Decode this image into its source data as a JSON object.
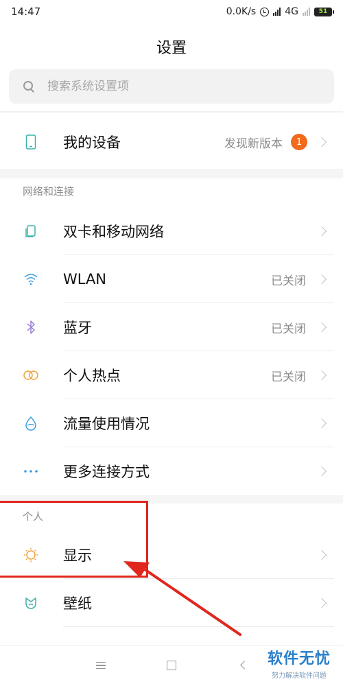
{
  "status_bar": {
    "time": "14:47",
    "speed": "0.0K/s",
    "network": "4G",
    "battery": "51"
  },
  "page_title": "设置",
  "search": {
    "placeholder": "搜索系统设置项"
  },
  "device": {
    "label": "我的设备",
    "value": "发现新版本",
    "badge": "1"
  },
  "network_section": {
    "title": "网络和连接",
    "items": [
      {
        "label": "双卡和移动网络",
        "value": "",
        "icon": "sim-cards-icon"
      },
      {
        "label": "WLAN",
        "value": "已关闭",
        "icon": "wifi-icon"
      },
      {
        "label": "蓝牙",
        "value": "已关闭",
        "icon": "bluetooth-icon"
      },
      {
        "label": "个人热点",
        "value": "已关闭",
        "icon": "hotspot-icon"
      },
      {
        "label": "流量使用情况",
        "value": "",
        "icon": "data-usage-icon"
      },
      {
        "label": "更多连接方式",
        "value": "",
        "icon": "more-dots-icon"
      }
    ]
  },
  "personal_section": {
    "title": "个人",
    "items": [
      {
        "label": "显示",
        "icon": "brightness-icon"
      },
      {
        "label": "壁纸",
        "icon": "wallpaper-icon"
      }
    ]
  },
  "watermark": {
    "main": "软件无忧",
    "sub": "努力解决软件问题"
  },
  "colors": {
    "badge": "#f26a1b",
    "annotation": "#e0261d",
    "watermark": "#2a7fc9"
  }
}
